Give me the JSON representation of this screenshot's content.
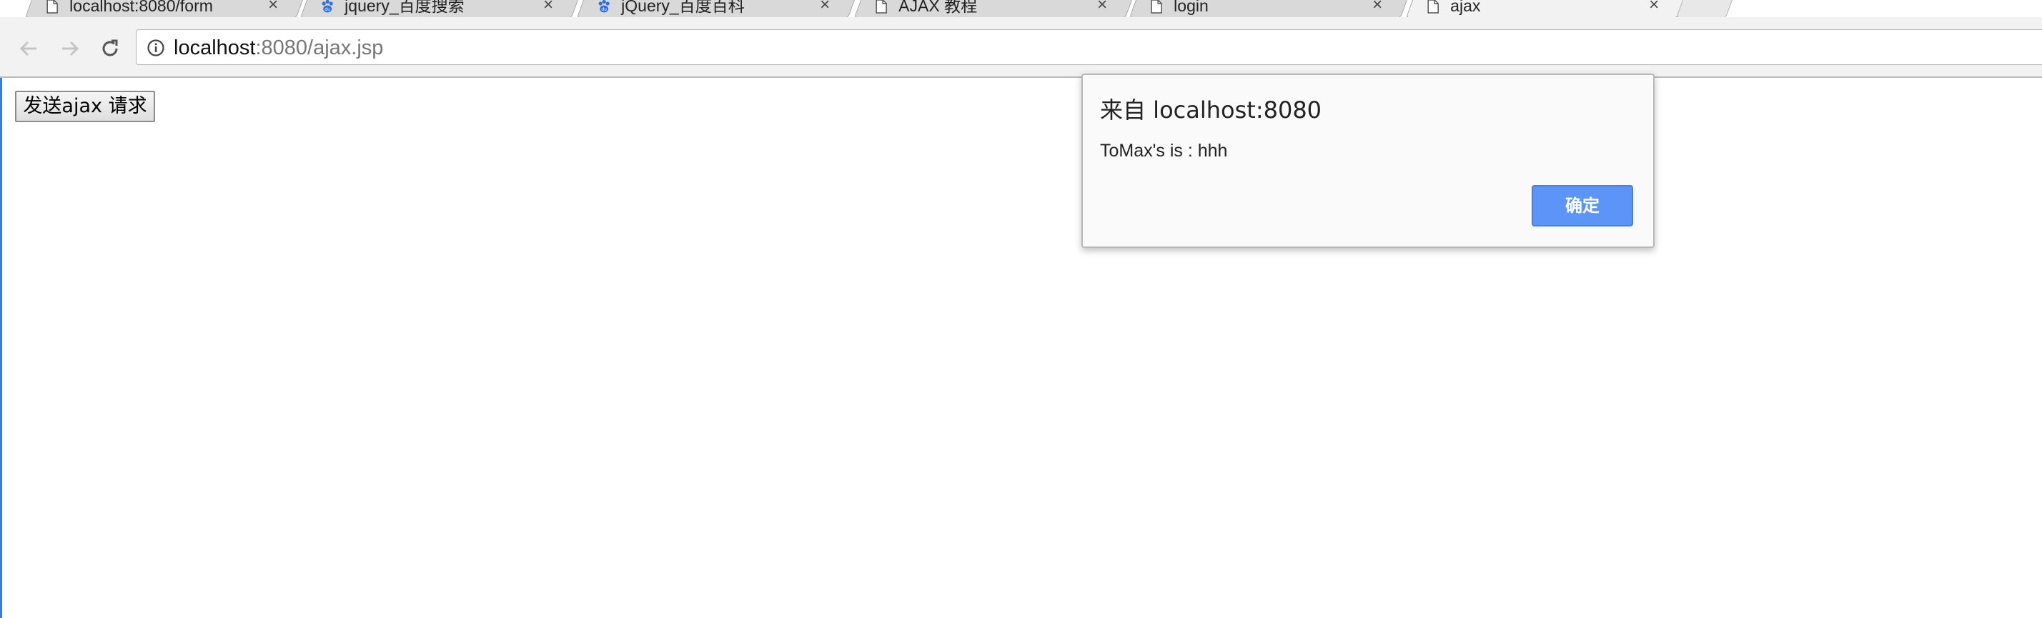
{
  "browser": {
    "tabs": [
      {
        "title": "localhost:8080/form",
        "icon": "page-icon",
        "active": false
      },
      {
        "title": "jquery_百度搜索",
        "icon": "baidu-paw-icon",
        "active": false
      },
      {
        "title": "jQuery_百度百科",
        "icon": "baidu-paw-icon",
        "active": false
      },
      {
        "title": "AJAX 教程",
        "icon": "page-icon",
        "active": false
      },
      {
        "title": "login",
        "icon": "page-icon",
        "active": false
      },
      {
        "title": "ajax",
        "icon": "page-icon",
        "active": true
      }
    ],
    "close_glyph": "×",
    "address": {
      "host": "localhost",
      "path": ":8080/ajax.jsp"
    }
  },
  "page": {
    "send_button_label": "发送ajax 请求"
  },
  "alert": {
    "title": "来自 localhost:8080",
    "message": "ToMax's is : hhh",
    "ok_label": "确定"
  },
  "colors": {
    "dialog_button": "#5c95f7",
    "accent": "#3d7bd9"
  }
}
